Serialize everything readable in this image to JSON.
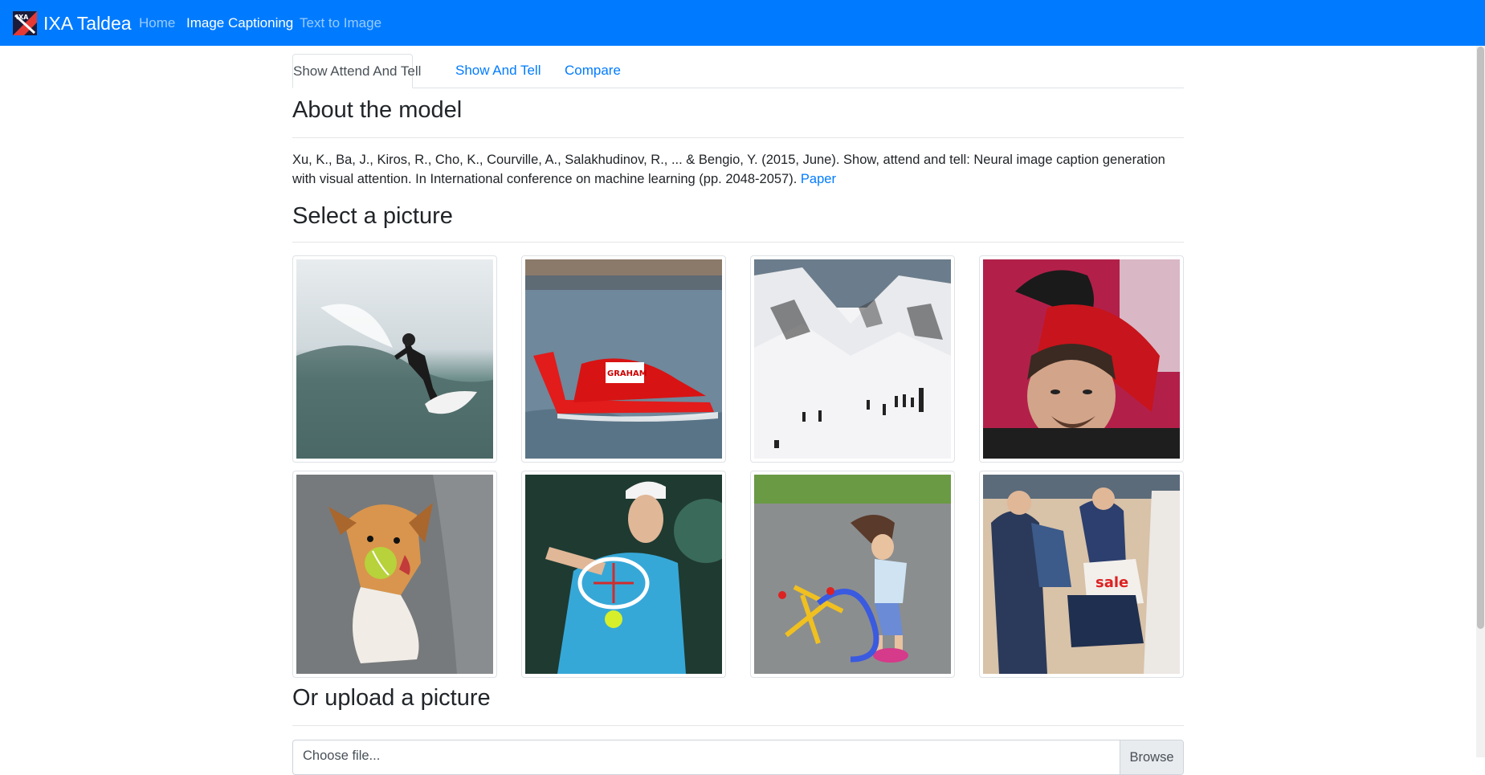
{
  "navbar": {
    "brand": "IXA Taldea",
    "logo_text": "IXA",
    "links": [
      "Home",
      "Image Captioning",
      "Text to Image"
    ],
    "active_link": "Image Captioning",
    "background": "#007bff"
  },
  "tabs": [
    "Show Attend And Tell",
    "Show And Tell",
    "Compare"
  ],
  "about": {
    "heading": "About the model",
    "citation": "Xu, K., Ba, J., Kiros, R., Cho, K., Courville, A., Salakhudinov, R., ... & Bengio, Y. (2015, June). Show, attend and tell: Neural image caption generation with visual attention. In International conference on machine learning (pp. 2048-2057).",
    "paper_link": "Paper"
  },
  "gallery": {
    "heading": "Select a picture",
    "images": [
      {
        "name": "surfer-image"
      },
      {
        "name": "racing-boat-image"
      },
      {
        "name": "snowy-mountain-image"
      },
      {
        "name": "man-carrying-child-image"
      },
      {
        "name": "dog-with-ball-image"
      },
      {
        "name": "tennis-player-image"
      },
      {
        "name": "kid-stomp-rocket-image"
      },
      {
        "name": "crowd-street-image"
      }
    ],
    "boat_text": "GRAHAM",
    "sale_text": "sale"
  },
  "upload": {
    "heading": "Or upload a picture",
    "placeholder": "Choose file...",
    "browse_label": "Browse"
  }
}
